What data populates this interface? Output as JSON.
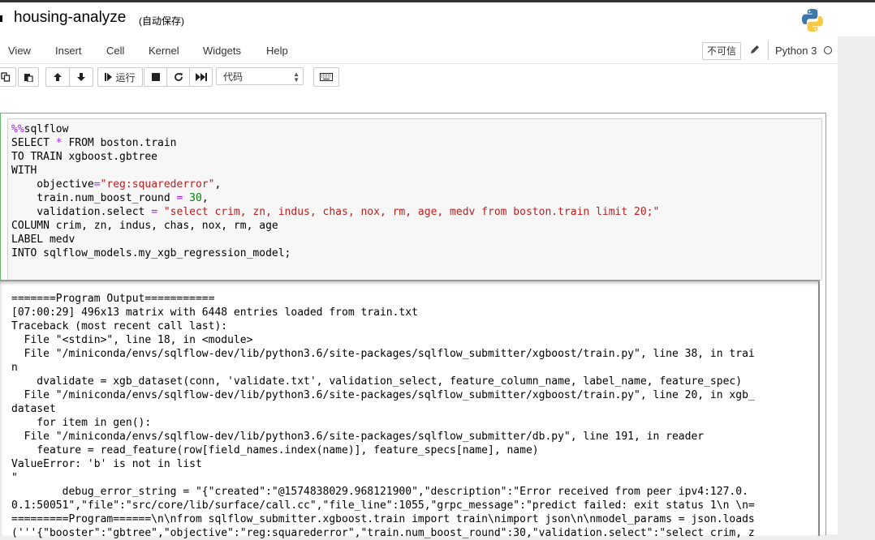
{
  "header": {
    "title": "housing-analyze",
    "autosave": "(自动保存)"
  },
  "menu": {
    "items": [
      "View",
      "Insert",
      "Cell",
      "Kernel",
      "Widgets",
      "Help"
    ],
    "trust": "不可信",
    "kernel": "Python 3"
  },
  "toolbar": {
    "run_label": "运行",
    "celltype": "代码"
  },
  "cell": {
    "code_lines": [
      "%%sqlflow",
      "SELECT * FROM boston.train",
      "TO TRAIN xgboost.gbtree",
      "WITH",
      "    objective=\"reg:squarederror\",",
      "    train.num_boost_round = 30,",
      "    validation.select = \"select crim, zn, indus, chas, nox, rm, age, medv from boston.train limit 20;\"",
      "COLUMN crim, zn, indus, chas, nox, rm, age",
      "LABEL medv",
      "INTO sqlflow_models.my_xgb_regression_model;"
    ],
    "output_lines": [
      "=======Program Output===========",
      "[07:00:29] 496x13 matrix with 6448 entries loaded from train.txt",
      "Traceback (most recent call last):",
      "  File \"<stdin>\", line 18, in <module>",
      "  File \"/miniconda/envs/sqlflow-dev/lib/python3.6/site-packages/sqlflow_submitter/xgboost/train.py\", line 38, in trai",
      "n",
      "    dvalidate = xgb_dataset(conn, 'validate.txt', validation_select, feature_column_name, label_name, feature_spec)",
      "  File \"/miniconda/envs/sqlflow-dev/lib/python3.6/site-packages/sqlflow_submitter/xgboost/train.py\", line 20, in xgb_",
      "dataset",
      "    for item in gen():",
      "  File \"/miniconda/envs/sqlflow-dev/lib/python3.6/site-packages/sqlflow_submitter/db.py\", line 191, in reader",
      "    feature = read_feature(row[field_names.index(name)], feature_specs[name], name)",
      "ValueError: 'b' is not in list",
      "\"",
      "        debug_error_string = \"{\"created\":\"@1574838029.968121900\",\"description\":\"Error received from peer ipv4:127.0.",
      "0.1:50051\",\"file\":\"src/core/lib/surface/call.cc\",\"file_line\":1055,\"grpc_message\":\"predict failed: exit status 1\\n \\n=",
      "=========Program======\\n\\nfrom sqlflow_submitter.xgboost.train import train\\nimport json\\n\\nmodel_params = json.loads",
      "('''{\"booster\":\"gbtree\",\"objective\":\"reg:squarederror\",\"train.num_boost_round\":30,\"validation.select\":\"select crim, z"
    ]
  }
}
